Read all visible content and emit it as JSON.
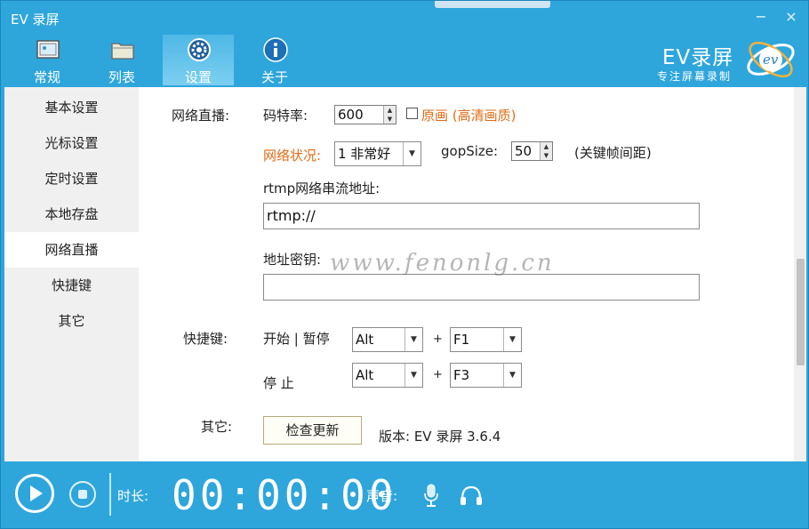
{
  "window": {
    "title": "EV 录屏",
    "minimize_glyph": "−",
    "close_glyph": "×"
  },
  "toolbar": {
    "tabs": [
      {
        "label": "常规",
        "icon": "image-frame-icon"
      },
      {
        "label": "列表",
        "icon": "folder-icon"
      },
      {
        "label": "设置",
        "icon": "gear-icon"
      },
      {
        "label": "关于",
        "icon": "info-icon"
      }
    ],
    "active_tab": "设置"
  },
  "logo": {
    "name": "EV录屏",
    "slogan": "专注屏幕录制",
    "badge_text": "ev"
  },
  "sidebar": {
    "items": [
      {
        "label": "基本设置"
      },
      {
        "label": "光标设置"
      },
      {
        "label": "定时设置"
      },
      {
        "label": "本地存盘"
      },
      {
        "label": "网络直播"
      },
      {
        "label": "快捷键"
      },
      {
        "label": "其它"
      }
    ],
    "active": "网络直播"
  },
  "live": {
    "section_label": "网络直播:",
    "bitrate_label": "码特率:",
    "bitrate_value": "600",
    "original_checkbox_label": "原画 (高清画质)",
    "original_checked": false,
    "network_label": "网络状况:",
    "network_value": "1  非常好",
    "gop_label": "gopSize:",
    "gop_value": "50",
    "gop_note": "(关键帧间距)",
    "rtmp_label": "rtmp网络串流地址:",
    "rtmp_value": "rtmp://",
    "key_label": "地址密钥:",
    "key_value": ""
  },
  "hotkeys": {
    "section_label": "快捷键:",
    "start_label": "开始 | 暂停",
    "start_mod": "Alt",
    "start_key": "F1",
    "stop_label": "停        止",
    "stop_mod": "Alt",
    "stop_key": "F3",
    "plus": "+"
  },
  "other": {
    "section_label": "其它:",
    "update_button": "检查更新",
    "version_text": "版本: EV 录屏 3.6.4"
  },
  "watermark": "www.fenonlg.cn",
  "bottombar": {
    "duration_label": "时长:",
    "timer": "00:00:00",
    "audio_label": "声音:"
  },
  "colors": {
    "chrome_blue": "#2ea6dc",
    "accent_orange": "#e36b16",
    "sidebar_bg": "#f0f0f0"
  }
}
